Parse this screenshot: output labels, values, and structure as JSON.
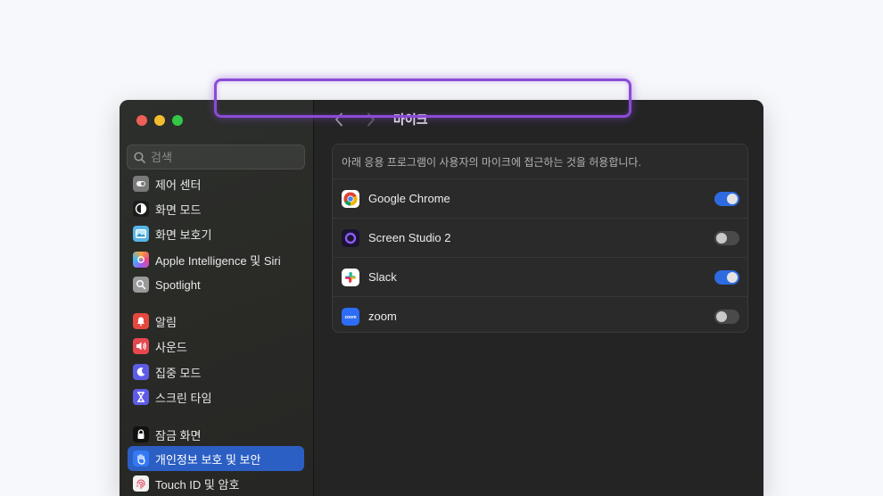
{
  "window": {
    "traffic_lights": {
      "close": "#ee5f57",
      "minimize": "#f2bc2e",
      "zoom": "#33c748"
    }
  },
  "sidebar": {
    "search_placeholder": "검색",
    "items": [
      {
        "label": "제어 센터",
        "icon": "control-center-icon",
        "color": "#7a7a7a",
        "active": false
      },
      {
        "label": "화면 모드",
        "icon": "appearance-icon",
        "color": "#1c1c1c",
        "active": false
      },
      {
        "label": "화면 보호기",
        "icon": "screen-saver-icon",
        "color": "#58b4e6",
        "active": false
      },
      {
        "label": "Apple Intelligence 및 Siri",
        "icon": "siri-icon",
        "color": "#d45fcf",
        "active": false
      },
      {
        "label": "Spotlight",
        "icon": "spotlight-icon",
        "color": "#9a9a9a",
        "active": false
      },
      {
        "label": "알림",
        "icon": "notifications-icon",
        "color": "#e5483f",
        "active": false
      },
      {
        "label": "사운드",
        "icon": "sound-icon",
        "color": "#e5484f",
        "active": false
      },
      {
        "label": "집중 모드",
        "icon": "focus-icon",
        "color": "#5e5ce6",
        "active": false
      },
      {
        "label": "스크린 타임",
        "icon": "screen-time-icon",
        "color": "#5e5ce6",
        "active": false
      },
      {
        "label": "잠금 화면",
        "icon": "lock-screen-icon",
        "color": "#111111",
        "active": false
      },
      {
        "label": "개인정보 보호 및 보안",
        "icon": "privacy-hand-icon",
        "color": "#3478f6",
        "active": true
      },
      {
        "label": "Touch ID 및 암호",
        "icon": "fingerprint-icon",
        "color": "#f1f1f1",
        "active": false
      }
    ]
  },
  "main": {
    "title": "마이크",
    "description": "아래 응용 프로그램이 사용자의 마이크에 접근하는 것을 허용합니다.",
    "apps": [
      {
        "name": "Google Chrome",
        "icon": "chrome-icon",
        "enabled": true,
        "highlighted": true
      },
      {
        "name": "Screen Studio 2",
        "icon": "screen-studio-icon",
        "enabled": false,
        "highlighted": false
      },
      {
        "name": "Slack",
        "icon": "slack-icon",
        "enabled": true,
        "highlighted": false
      },
      {
        "name": "zoom",
        "icon": "zoom-icon",
        "enabled": false,
        "highlighted": false
      }
    ],
    "accent_color": "#2f6be0",
    "highlight_color": "#8a4bd8"
  }
}
